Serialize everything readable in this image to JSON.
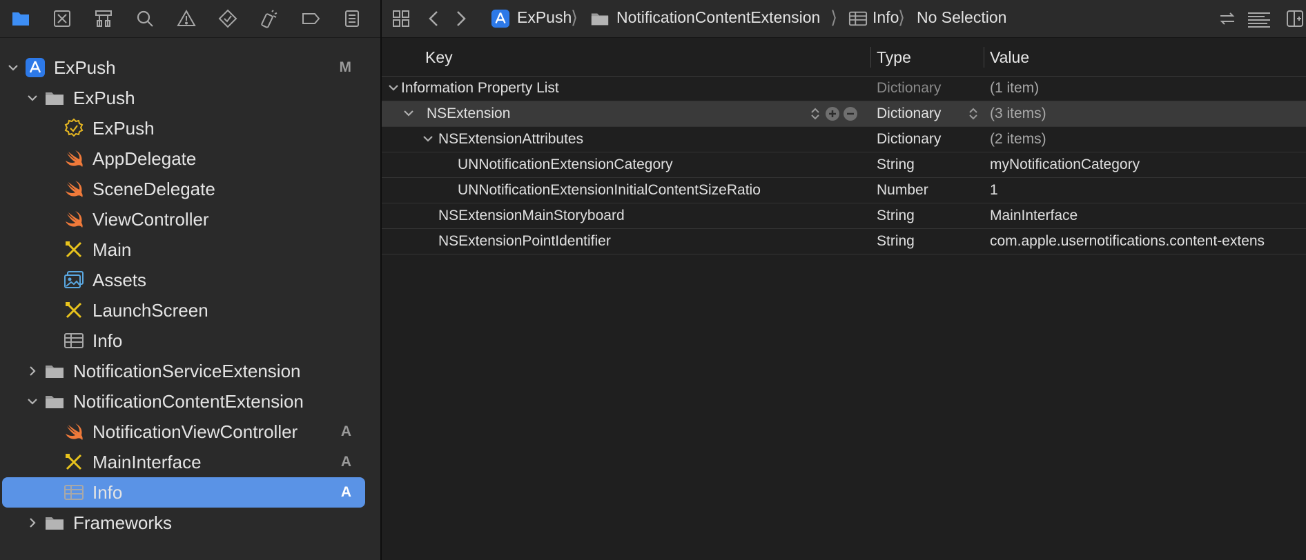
{
  "navigator": {
    "toolbar_icons": [
      "folder-icon",
      "source-control-icon",
      "symbol-icon",
      "find-icon",
      "issue-icon",
      "test-icon",
      "debug-icon",
      "breakpoint-icon",
      "report-icon"
    ],
    "tree": [
      {
        "label": "ExPush",
        "icon": "xcode-project-icon",
        "indent": 0,
        "chevron": "down",
        "badge": "M"
      },
      {
        "label": "ExPush",
        "icon": "folder-icon",
        "indent": 1,
        "chevron": "down",
        "badge": ""
      },
      {
        "label": "ExPush",
        "icon": "entitlements-icon",
        "indent": 2,
        "chevron": "",
        "badge": ""
      },
      {
        "label": "AppDelegate",
        "icon": "swift-icon",
        "indent": 2,
        "chevron": "",
        "badge": ""
      },
      {
        "label": "SceneDelegate",
        "icon": "swift-icon",
        "indent": 2,
        "chevron": "",
        "badge": ""
      },
      {
        "label": "ViewController",
        "icon": "swift-icon",
        "indent": 2,
        "chevron": "",
        "badge": ""
      },
      {
        "label": "Main",
        "icon": "storyboard-icon",
        "indent": 2,
        "chevron": "",
        "badge": ""
      },
      {
        "label": "Assets",
        "icon": "assets-icon",
        "indent": 2,
        "chevron": "",
        "badge": ""
      },
      {
        "label": "LaunchScreen",
        "icon": "storyboard-icon",
        "indent": 2,
        "chevron": "",
        "badge": ""
      },
      {
        "label": "Info",
        "icon": "plist-icon",
        "indent": 2,
        "chevron": "",
        "badge": ""
      },
      {
        "label": "NotificationServiceExtension",
        "icon": "folder-icon",
        "indent": 1,
        "chevron": "right",
        "badge": ""
      },
      {
        "label": "NotificationContentExtension",
        "icon": "folder-icon",
        "indent": 1,
        "chevron": "down",
        "badge": ""
      },
      {
        "label": "NotificationViewController",
        "icon": "swift-icon",
        "indent": 2,
        "chevron": "",
        "badge": "A"
      },
      {
        "label": "MainInterface",
        "icon": "storyboard-icon",
        "indent": 2,
        "chevron": "",
        "badge": "A"
      },
      {
        "label": "Info",
        "icon": "plist-icon",
        "indent": 2,
        "chevron": "",
        "badge": "A",
        "selected": true
      },
      {
        "label": "Frameworks",
        "icon": "folder-icon",
        "indent": 1,
        "chevron": "right",
        "badge": ""
      }
    ]
  },
  "jumpbar": {
    "crumbs": [
      {
        "label": "ExPush",
        "icon": "xcode-project-icon"
      },
      {
        "label": "NotificationContentExtension",
        "icon": "folder-icon"
      },
      {
        "label": "Info",
        "icon": "plist-icon"
      },
      {
        "label": "No Selection",
        "icon": ""
      }
    ]
  },
  "plist": {
    "columns": {
      "key": "Key",
      "type": "Type",
      "value": "Value"
    },
    "rows": [
      {
        "key": "Information Property List",
        "type": "Dictionary",
        "value": "(1 item)",
        "depth": 0,
        "chevron": "down",
        "type_muted": true,
        "value_muted": true
      },
      {
        "key": "NSExtension",
        "type": "Dictionary",
        "value": "(3 items)",
        "depth": 1,
        "chevron": "down",
        "selected": true,
        "value_muted": true
      },
      {
        "key": "NSExtensionAttributes",
        "type": "Dictionary",
        "value": "(2 items)",
        "depth": 2,
        "chevron": "down",
        "value_muted": true
      },
      {
        "key": "UNNotificationExtensionCategory",
        "type": "String",
        "value": "myNotificationCategory",
        "depth": 3,
        "chevron": ""
      },
      {
        "key": "UNNotificationExtensionInitialContentSizeRatio",
        "type": "Number",
        "value": "1",
        "depth": 3,
        "chevron": ""
      },
      {
        "key": "NSExtensionMainStoryboard",
        "type": "String",
        "value": "MainInterface",
        "depth": 2,
        "chevron": ""
      },
      {
        "key": "NSExtensionPointIdentifier",
        "type": "String",
        "value": "com.apple.usernotifications.content-extens",
        "depth": 2,
        "chevron": ""
      }
    ]
  },
  "colors": {
    "accent": "#3d8ef5",
    "selection": "#5a93e6",
    "swift": "#f07a3a",
    "storyboard": "#e8c31d"
  }
}
